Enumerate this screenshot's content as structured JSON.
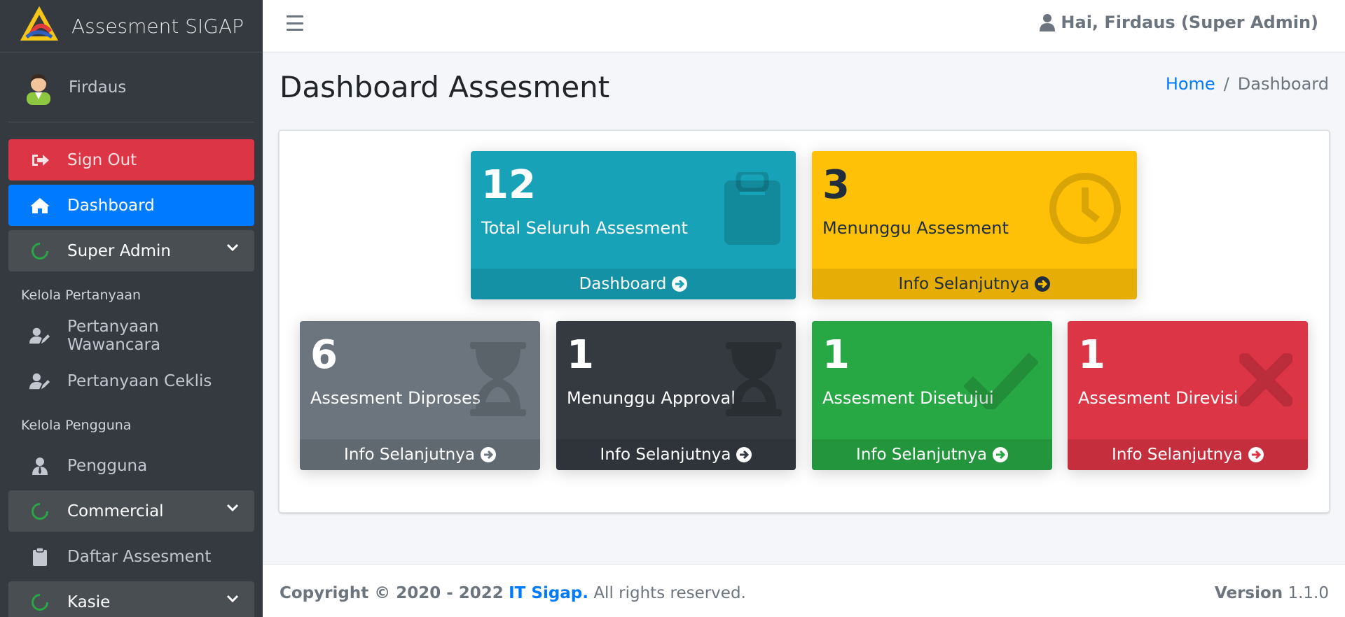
{
  "brand": {
    "title": "Assesment SIGAP"
  },
  "user_panel": {
    "name": "Firdaus"
  },
  "sidebar": {
    "sign_out": "Sign Out",
    "dashboard": "Dashboard",
    "group_super_admin": "Super Admin",
    "header_kelola_pertanyaan": "Kelola Pertanyaan",
    "pertanyaan_wawancara": "Pertanyaan Wawancara",
    "pertanyaan_ceklis": "Pertanyaan Ceklis",
    "header_kelola_pengguna": "Kelola Pengguna",
    "pengguna": "Pengguna",
    "group_commercial": "Commercial",
    "daftar_assesment": "Daftar Assesment",
    "group_kasie": "Kasie"
  },
  "topbar": {
    "greeting": "Hai, Firdaus (Super Admin)"
  },
  "header": {
    "title": "Dashboard Assesment"
  },
  "breadcrumb": {
    "home": "Home",
    "sep": "/",
    "current": "Dashboard"
  },
  "boxes": {
    "total": {
      "value": "12",
      "label": "Total Seluruh Assesment",
      "link": "Dashboard",
      "icon": "clipboard-icon",
      "color": "#17a2b8"
    },
    "menunggu": {
      "value": "3",
      "label": "Menunggu Assesment",
      "link": "Info Selanjutnya",
      "icon": "clock-icon",
      "color": "#ffc107"
    },
    "diproses": {
      "value": "6",
      "label": "Assesment Diproses",
      "link": "Info Selanjutnya",
      "icon": "hourglass-icon",
      "color": "#6c757d"
    },
    "approval": {
      "value": "1",
      "label": "Menunggu Approval",
      "link": "Info Selanjutnya",
      "icon": "hourglass-icon",
      "color": "#343a40"
    },
    "disetujui": {
      "value": "1",
      "label": "Assesment Disetujui",
      "link": "Info Selanjutnya",
      "icon": "check-icon",
      "color": "#28a745"
    },
    "direvisi": {
      "value": "1",
      "label": "Assesment Direvisi",
      "link": "Info Selanjutnya",
      "icon": "times-icon",
      "color": "#dc3545"
    }
  },
  "footer": {
    "copyright_prefix": "Copyright © 2020 - 2022",
    "company": "IT Sigap.",
    "rights": "All rights reserved.",
    "version_label": "Version",
    "version_value": "1.1.0"
  }
}
